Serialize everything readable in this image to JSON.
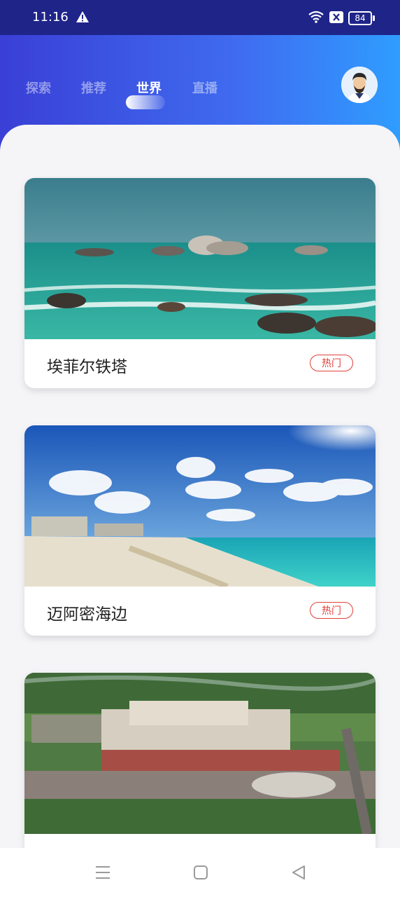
{
  "status": {
    "time": "11:16",
    "battery": "84"
  },
  "tabs": [
    {
      "label": "探索"
    },
    {
      "label": "推荐"
    },
    {
      "label": "世界"
    },
    {
      "label": "直播"
    }
  ],
  "active_tab": "世界",
  "cards": [
    {
      "title": "埃菲尔铁塔",
      "badge": "热门"
    },
    {
      "title": "迈阿密海边",
      "badge": "热门"
    },
    {
      "title": "",
      "badge": ""
    }
  ],
  "colors": {
    "status_bg": "#1f2489",
    "badge": "#e0403a",
    "header_start": "#3a3fd6",
    "header_end": "#2f9dff"
  },
  "icons": [
    "warning-icon",
    "wifi-icon",
    "sim-icon",
    "battery-icon",
    "avatar",
    "menu-icon",
    "home-icon",
    "back-icon"
  ]
}
